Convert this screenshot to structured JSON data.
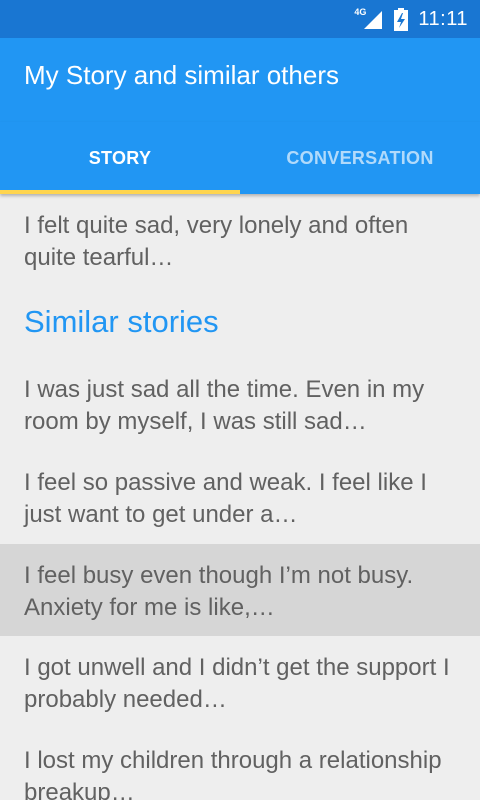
{
  "status_bar": {
    "network": "4G",
    "time": "11:11"
  },
  "app_bar": {
    "title": "My Story and similar others"
  },
  "tabs": [
    {
      "label": "STORY",
      "selected": true
    },
    {
      "label": "CONVERSATION",
      "selected": false
    }
  ],
  "my_story": {
    "text": "I felt quite sad, very lonely and often quite tearful…"
  },
  "similar": {
    "heading": "Similar stories",
    "items": [
      {
        "text": "I was just sad all the time. Even in my room by myself, I was still sad…"
      },
      {
        "text": "I feel so passive and weak. I feel like I just want to get under a…"
      },
      {
        "text": "I feel busy even though I’m not busy. Anxiety for me is like,…"
      },
      {
        "text": "I got unwell and I didn’t get the support I probably needed…"
      },
      {
        "text": "I lost my children through a relationship breakup…"
      }
    ]
  },
  "colors": {
    "status_bar": "#1976d2",
    "app_bar": "#2196f3",
    "tab_indicator": "#ffd54f",
    "heading": "#2196f3",
    "text": "#616161",
    "background": "#eeeeee",
    "selected_row": "#d6d6d6"
  }
}
